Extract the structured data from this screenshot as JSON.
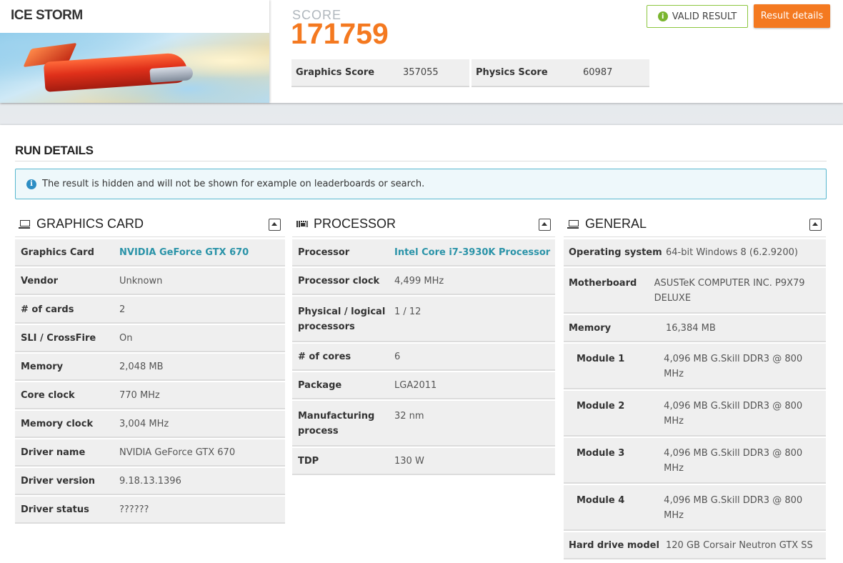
{
  "header": {
    "test_name": "ICE STORM",
    "score_label": "SCORE",
    "score_value": "171759",
    "subscores": [
      {
        "label": "Graphics Score",
        "value": "357055"
      },
      {
        "label": "Physics Score",
        "value": "60987"
      }
    ],
    "valid_label": "VALID RESULT",
    "details_label": "Result details"
  },
  "run_details": {
    "title": "RUN DETAILS",
    "notice": "The result is hidden and will not be shown for example on leaderboards or search."
  },
  "graphics": {
    "title": "GRAPHICS CARD",
    "rows": [
      {
        "k": "Graphics Card",
        "v": "NVIDIA GeForce GTX 670"
      },
      {
        "k": "Vendor",
        "v": "Unknown"
      },
      {
        "k": "# of cards",
        "v": "2"
      },
      {
        "k": "SLI / CrossFire",
        "v": "On"
      },
      {
        "k": "Memory",
        "v": "2,048 MB"
      },
      {
        "k": "Core clock",
        "v": "770 MHz"
      },
      {
        "k": "Memory clock",
        "v": "3,004 MHz"
      },
      {
        "k": "Driver name",
        "v": "NVIDIA GeForce GTX 670"
      },
      {
        "k": "Driver version",
        "v": "9.18.13.1396"
      },
      {
        "k": "Driver status",
        "v": "??????"
      }
    ]
  },
  "processor": {
    "title": "PROCESSOR",
    "rows": [
      {
        "k": "Processor",
        "v": "Intel Core i7-3930K Processor"
      },
      {
        "k": "Processor clock",
        "v": "4,499 MHz"
      },
      {
        "k": "Physical / logical processors",
        "v": "1 / 12"
      },
      {
        "k": "# of cores",
        "v": "6"
      },
      {
        "k": "Package",
        "v": "LGA2011"
      },
      {
        "k": "Manufacturing process",
        "v": "32 nm"
      },
      {
        "k": "TDP",
        "v": "130 W"
      }
    ]
  },
  "general": {
    "title": "GENERAL",
    "rows": [
      {
        "k": "Operating system",
        "v": "64-bit Windows 8 (6.2.9200)"
      },
      {
        "k": "Motherboard",
        "v": "ASUSTeK COMPUTER INC. P9X79 DELUXE"
      },
      {
        "k": "Memory",
        "v": "16,384 MB"
      },
      {
        "k": "Module 1",
        "v": "4,096 MB G.Skill DDR3 @ 800 MHz"
      },
      {
        "k": "Module 2",
        "v": "4,096 MB G.Skill DDR3 @ 800 MHz"
      },
      {
        "k": "Module 3",
        "v": "4,096 MB G.Skill DDR3 @ 800 MHz"
      },
      {
        "k": "Module 4",
        "v": "4,096 MB G.Skill DDR3 @ 800 MHz"
      },
      {
        "k": "Hard drive model",
        "v": "120 GB Corsair Neutron GTX SS"
      }
    ]
  },
  "colors": {
    "accent_orange": "#f47920",
    "valid_green": "#7ab52f",
    "link_teal": "#2a93a8",
    "info_blue": "#2d8ec4"
  }
}
